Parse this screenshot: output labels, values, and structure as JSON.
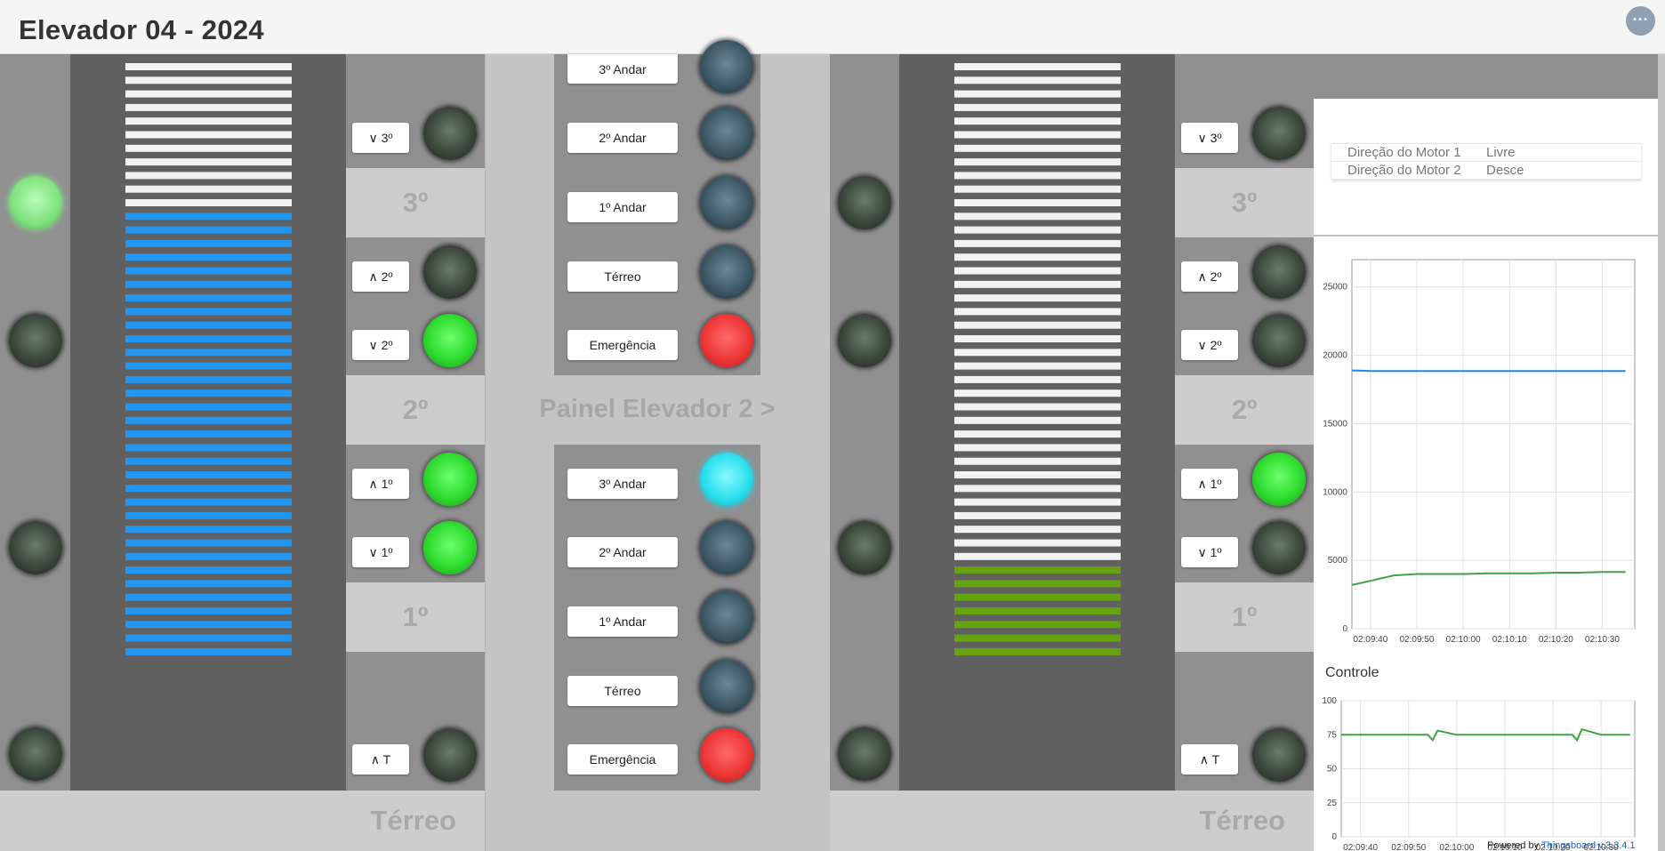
{
  "header": {
    "title": "Elevador 04 - 2024",
    "menu_icon": "more-icon"
  },
  "floors": {
    "third": "3º",
    "second": "2º",
    "first": "1º",
    "ground": "Térreo"
  },
  "elevator1": {
    "shaft_progress": 0.76,
    "buttons": {
      "down3": "∨ 3º",
      "up2": "∧ 2º",
      "down2": "∨ 2º",
      "up1": "∧ 1º",
      "down1": "∨ 1º",
      "upT": "∧ T"
    },
    "bar_color": "#2196f3"
  },
  "elevator2": {
    "shaft_progress": 0.15,
    "buttons": {
      "down3": "∨ 3º",
      "up2": "∧ 2º",
      "down2": "∨ 2º",
      "up1": "∧ 1º",
      "down1": "∨ 1º",
      "upT": "∧ T"
    },
    "bar_color": "#66a30f"
  },
  "panel1": {
    "labels": [
      "3º Andar",
      "2º Andar",
      "1º Andar",
      "Térreo",
      "Emergência"
    ]
  },
  "panel_title": "Painel Elevador 2 >",
  "panel2": {
    "labels": [
      "3º Andar",
      "2º Andar",
      "1º Andar",
      "Térreo",
      "Emergência"
    ]
  },
  "motor_table": {
    "rows": [
      {
        "key": "Direção do Motor 1",
        "value": "Livre"
      },
      {
        "key": "Direção do Motor 2",
        "value": "Desce"
      }
    ]
  },
  "chart_data": [
    {
      "type": "line",
      "title": "",
      "x": [
        "02:09:36",
        "02:09:40",
        "02:09:45",
        "02:09:50",
        "02:09:55",
        "02:10:00",
        "02:10:05",
        "02:10:10",
        "02:10:15",
        "02:10:20",
        "02:10:25",
        "02:10:30",
        "02:10:35"
      ],
      "xticks": [
        "02:09:40",
        "02:09:50",
        "02:10:00",
        "02:10:10",
        "02:10:20",
        "02:10:30"
      ],
      "ylim": [
        0,
        27000
      ],
      "yticks": [
        0,
        5000,
        10000,
        15000,
        20000,
        25000
      ],
      "series": [
        {
          "color": "#1e88e5",
          "values": [
            18900,
            18850,
            18850,
            18850,
            18850,
            18850,
            18850,
            18850,
            18850,
            18850,
            18850,
            18850,
            18850
          ]
        },
        {
          "color": "#43a047",
          "values": [
            3200,
            3500,
            3900,
            4000,
            4000,
            4000,
            4050,
            4050,
            4050,
            4100,
            4100,
            4150,
            4150
          ]
        }
      ]
    },
    {
      "type": "line",
      "title": "Controle",
      "x": [
        "02:09:36",
        "02:09:40",
        "02:09:45",
        "02:09:50",
        "02:09:54",
        "02:09:55",
        "02:09:56",
        "02:10:00",
        "02:10:05",
        "02:10:10",
        "02:10:15",
        "02:10:20",
        "02:10:24",
        "02:10:25",
        "02:10:26",
        "02:10:30",
        "02:10:36"
      ],
      "xticks": [
        "02:09:40",
        "02:09:50",
        "02:10:00",
        "02:10:10",
        "02:10:20",
        "02:10:30"
      ],
      "ylim": [
        0,
        100
      ],
      "yticks": [
        0,
        25,
        50,
        75,
        100
      ],
      "series": [
        {
          "color": "#43a047",
          "values": [
            75,
            75,
            75,
            75,
            75,
            71,
            78,
            75,
            75,
            75,
            75,
            75,
            75,
            71,
            79,
            75,
            75
          ]
        }
      ]
    }
  ],
  "footer": {
    "powered": "Powered by ",
    "link": "Thingsboard v.3.3.4.1"
  }
}
